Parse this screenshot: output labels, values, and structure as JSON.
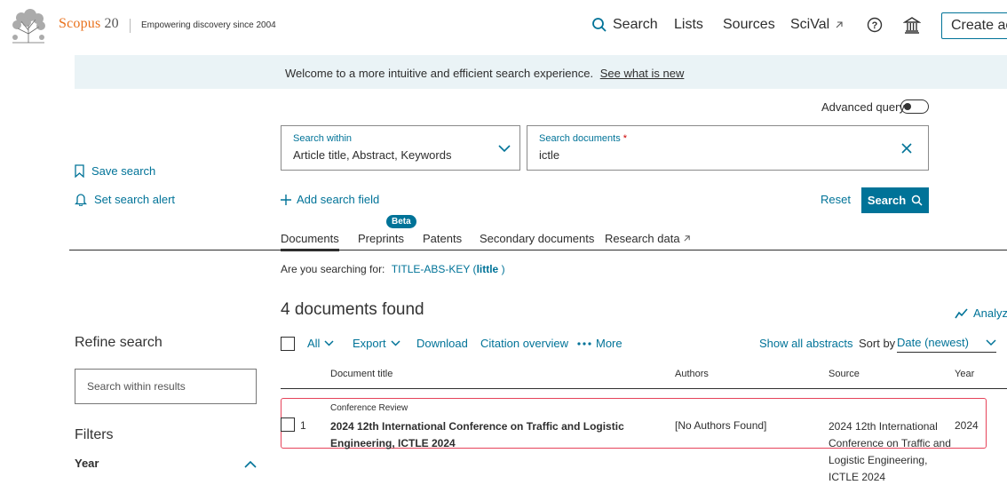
{
  "header": {
    "brand": "Scopus",
    "brand_number": "20",
    "tagline": "Empowering discovery since 2004",
    "nav": {
      "search": "Search",
      "lists": "Lists",
      "sources": "Sources",
      "scival": "SciVal",
      "create": "Create account"
    }
  },
  "banner": {
    "text": "Welcome to a more intuitive and efficient search experience.",
    "link": "See what is new"
  },
  "advanced_query": {
    "label": "Advanced query",
    "enabled": false
  },
  "search_form": {
    "within_label": "Search within",
    "within_value": "Article title, Abstract, Keywords",
    "docs_label": "Search documents",
    "docs_required": "*",
    "docs_value": "ictle",
    "add_field": "Add search field",
    "reset": "Reset",
    "search": "Search"
  },
  "sidebar": {
    "save_search": "Save search",
    "set_alert": "Set search alert",
    "refine": "Refine search",
    "within_results_placeholder": "Search within results",
    "filters": "Filters",
    "year": "Year"
  },
  "tabs": {
    "documents": "Documents",
    "preprints": "Preprints",
    "beta": "Beta",
    "patents": "Patents",
    "secondary": "Secondary documents",
    "research_data": "Research data"
  },
  "suggestion": {
    "label": "Are you searching for:",
    "query_prefix": "TITLE-ABS-KEY (",
    "query_term": "little",
    "query_suffix": ")"
  },
  "results": {
    "count_text": "4 documents found",
    "analyze": "Analyze results",
    "toolbar": {
      "all": "All",
      "export": "Export",
      "download": "Download",
      "citation": "Citation overview",
      "more": "More",
      "show_abstracts": "Show all abstracts",
      "sort_by": "Sort by",
      "sort_value": "Date (newest)"
    },
    "columns": {
      "title": "Document title",
      "authors": "Authors",
      "source": "Source",
      "year": "Year"
    },
    "rows": [
      {
        "num": "1",
        "type": "Conference Review",
        "title": "2024 12th International Conference on Traffic and Logistic Engineering, ICTLE 2024",
        "authors": "[No Authors Found]",
        "source": "2024 12th International Conference on Traffic and Logistic Engineering, ICTLE 2024",
        "year": "2024"
      }
    ]
  }
}
